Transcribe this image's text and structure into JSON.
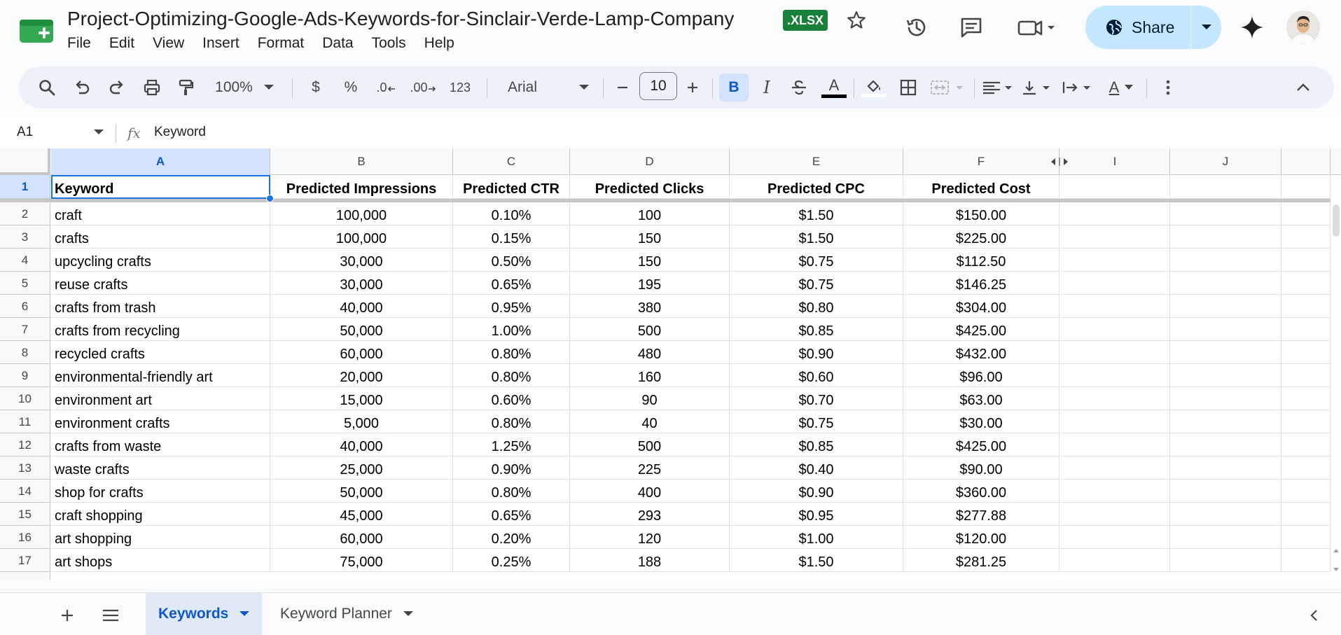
{
  "title_bar": {
    "doc_title": "Project-Optimizing-Google-Ads-Keywords-for-Sinclair-Verde-Lamp-Company",
    "badge": ".XLSX",
    "share_label": "Share"
  },
  "menu": [
    "File",
    "Edit",
    "View",
    "Insert",
    "Format",
    "Data",
    "Tools",
    "Help"
  ],
  "toolbar": {
    "zoom": "100%",
    "currency": "$",
    "percent": "%",
    "decrease_decimal": ".0",
    "increase_decimal": ".00",
    "number_format": "123",
    "font": "Arial",
    "font_size": "10",
    "bold": "B",
    "italic": "I",
    "text_color": "A",
    "text_rotation": "A"
  },
  "formula_bar": {
    "name_box": "A1",
    "fx": "fx",
    "content": "Keyword"
  },
  "columns": [
    "A",
    "B",
    "C",
    "D",
    "E",
    "F",
    "I",
    "J"
  ],
  "header_row": [
    "Keyword",
    "Predicted Impressions",
    "Predicted CTR",
    "Predicted Clicks",
    "Predicted CPC",
    "Predicted Cost"
  ],
  "rows": [
    {
      "num": "2",
      "cells": [
        "craft",
        "100,000",
        "0.10%",
        "100",
        "$1.50",
        "$150.00"
      ]
    },
    {
      "num": "3",
      "cells": [
        "crafts",
        "100,000",
        "0.15%",
        "150",
        "$1.50",
        "$225.00"
      ]
    },
    {
      "num": "4",
      "cells": [
        "upcycling crafts",
        "30,000",
        "0.50%",
        "150",
        "$0.75",
        "$112.50"
      ]
    },
    {
      "num": "5",
      "cells": [
        "reuse crafts",
        "30,000",
        "0.65%",
        "195",
        "$0.75",
        "$146.25"
      ]
    },
    {
      "num": "6",
      "cells": [
        "crafts from trash",
        "40,000",
        "0.95%",
        "380",
        "$0.80",
        "$304.00"
      ]
    },
    {
      "num": "7",
      "cells": [
        "crafts from recycling",
        "50,000",
        "1.00%",
        "500",
        "$0.85",
        "$425.00"
      ]
    },
    {
      "num": "8",
      "cells": [
        "recycled crafts",
        "60,000",
        "0.80%",
        "480",
        "$0.90",
        "$432.00"
      ]
    },
    {
      "num": "9",
      "cells": [
        "environmental-friendly art",
        "20,000",
        "0.80%",
        "160",
        "$0.60",
        "$96.00"
      ]
    },
    {
      "num": "10",
      "cells": [
        "environment art",
        "15,000",
        "0.60%",
        "90",
        "$0.70",
        "$63.00"
      ]
    },
    {
      "num": "11",
      "cells": [
        "environment crafts",
        "5,000",
        "0.80%",
        "40",
        "$0.75",
        "$30.00"
      ]
    },
    {
      "num": "12",
      "cells": [
        "crafts from waste",
        "40,000",
        "1.25%",
        "500",
        "$0.85",
        "$425.00"
      ]
    },
    {
      "num": "13",
      "cells": [
        "waste crafts",
        "25,000",
        "0.90%",
        "225",
        "$0.40",
        "$90.00"
      ]
    },
    {
      "num": "14",
      "cells": [
        "shop for crafts",
        "50,000",
        "0.80%",
        "400",
        "$0.90",
        "$360.00"
      ]
    },
    {
      "num": "15",
      "cells": [
        "craft shopping",
        "45,000",
        "0.65%",
        "293",
        "$0.95",
        "$277.88"
      ]
    },
    {
      "num": "16",
      "cells": [
        "art shopping",
        "60,000",
        "0.20%",
        "120",
        "$1.00",
        "$120.00"
      ]
    },
    {
      "num": "17",
      "cells": [
        "art shops",
        "75,000",
        "0.25%",
        "188",
        "$1.50",
        "$281.25"
      ]
    }
  ],
  "sheets": [
    {
      "label": "Keywords",
      "active": true
    },
    {
      "label": "Keyword Planner",
      "active": false
    }
  ],
  "colors": {
    "accent": "#0b57d0",
    "share_bg": "#c2e7ff",
    "badge_green": "#188038",
    "selection": "#1a73e8"
  }
}
